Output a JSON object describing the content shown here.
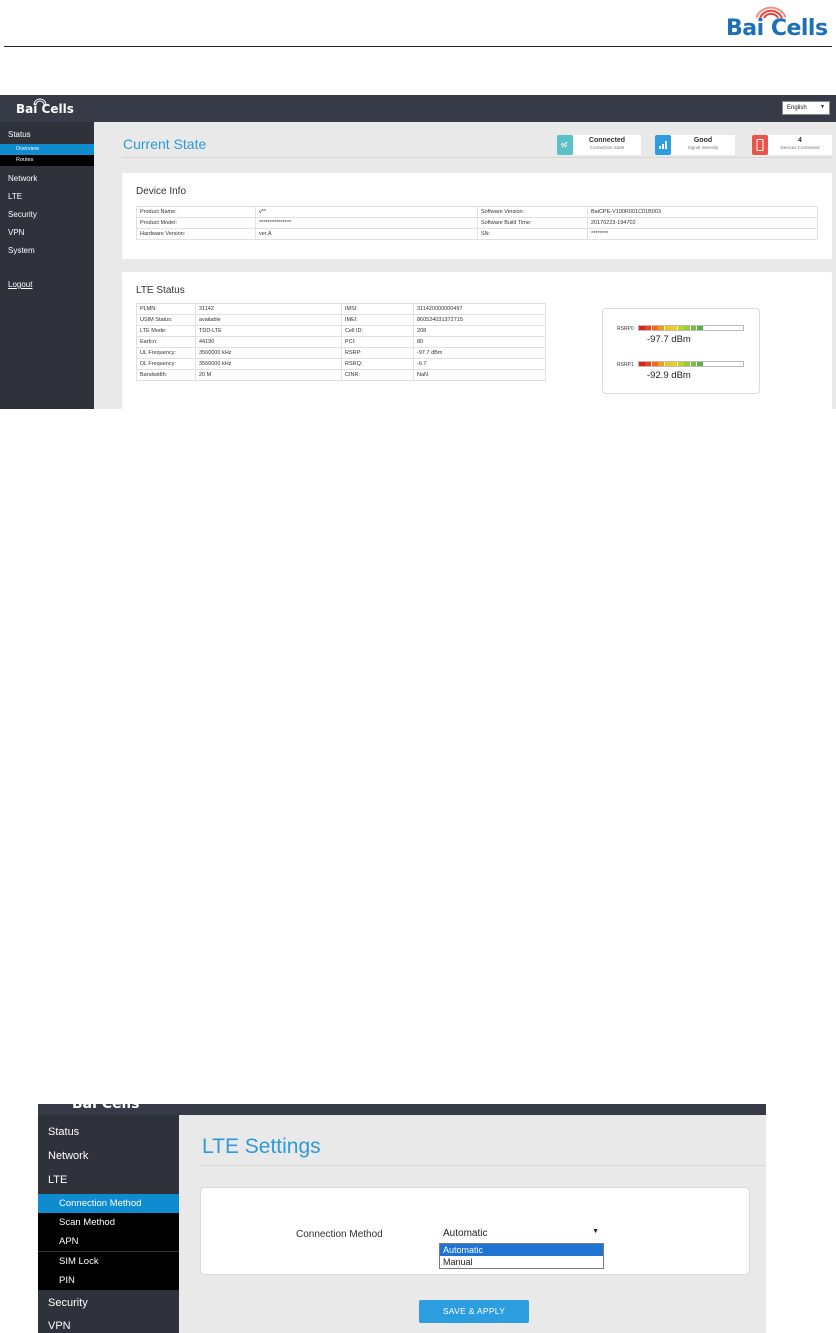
{
  "document": {
    "logo_text": "Bai Cells"
  },
  "screen1": {
    "logo": "Bai Cells",
    "language": "English",
    "sidebar": {
      "status": "Status",
      "sub_overview": "Overview",
      "sub_routes": "Routes",
      "network": "Network",
      "lte": "LTE",
      "security": "Security",
      "vpn": "VPN",
      "system": "System",
      "logout": "Logout"
    },
    "page_title": "Current State",
    "status_cards": [
      {
        "value": "Connected",
        "label": "Connection State",
        "color": "#5bc0c8",
        "icon": "link-icon"
      },
      {
        "value": "Good",
        "label": "Signal Intensity",
        "color": "#2c9de0",
        "icon": "signal-bars-icon"
      },
      {
        "value": "4",
        "label": "Devices Connected",
        "color": "#e8534a",
        "icon": "phone-icon"
      }
    ],
    "device_info": {
      "title": "Device Info",
      "rows": [
        [
          "Product Name:",
          "v**",
          "Software Version:",
          "BaiCPE-V100R001C01B003"
        ],
        [
          "Product Model:",
          "***************",
          "Software Build Time:",
          "20170223-194702"
        ],
        [
          "Hardware Version:",
          "ver.A",
          "SN:",
          "********"
        ]
      ]
    },
    "lte_status": {
      "title": "LTE Status",
      "rows": [
        [
          "PLMN:",
          "31142",
          "IMSI:",
          "311420000000497"
        ],
        [
          "USIM Status:",
          "available",
          "IMEI:",
          "860524031372715"
        ],
        [
          "LTE Mode:",
          "TDD-LTE",
          "Cell ID:",
          "208"
        ],
        [
          "Earfcn:",
          "44190",
          "PCI:",
          "80"
        ],
        [
          "UL Frequency:",
          "3560000 kHz",
          "RSRP:",
          "-97.7 dBm"
        ],
        [
          "DL Frequency:",
          "3560000 kHz",
          "RSRQ:",
          "-6.7"
        ],
        [
          "Bandwidth:",
          "20 M",
          "CINR:",
          "NaN"
        ]
      ]
    },
    "meters": [
      {
        "label": "RSRP0",
        "value": "-97.7 dBm",
        "level": 0.62
      },
      {
        "label": "RSRP1",
        "value": "-92.9 dBm",
        "level": 0.62
      }
    ]
  },
  "screen2": {
    "logo": "Bai Cells",
    "sidebar": {
      "status": "Status",
      "network": "Network",
      "lte": "LTE",
      "sub_connection_method": "Connection Method",
      "sub_scan_method": "Scan Method",
      "sub_apn": "APN",
      "sub_sim_lock": "SIM Lock",
      "sub_pin": "PIN",
      "security": "Security",
      "vpn": "VPN"
    },
    "page_title": "LTE Settings",
    "connection_method_label": "Connection Method",
    "select_value": "Automatic",
    "options": [
      "Automatic",
      "Manual"
    ],
    "save_button": "SAVE & APPLY"
  }
}
